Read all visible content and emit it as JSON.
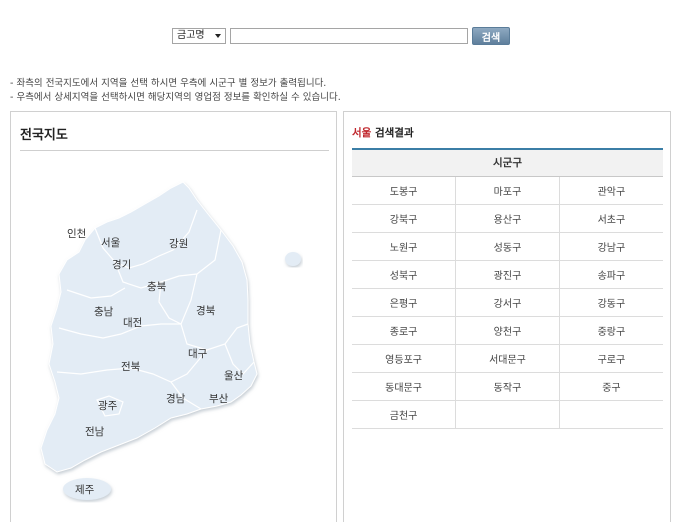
{
  "search": {
    "select_value": "금고명",
    "input_value": "",
    "button_label": "검색"
  },
  "guide": [
    "- 좌측의 전국지도에서 지역을 선택 하시면 우측에 시군구 별 정보가 출력됩니다.",
    "- 우측에서 상세지역을 선택하시면 해당지역의 영업점 정보를 확인하실 수 있습니다."
  ],
  "map": {
    "title": "전국지도",
    "regions": {
      "incheon": "인천",
      "seoul": "서울",
      "gangwon": "강원",
      "gyeonggi": "경기",
      "chungbuk": "충북",
      "chungnam": "충남",
      "daejeon": "대전",
      "gyeongbuk": "경북",
      "jeonbuk": "전북",
      "daegu": "대구",
      "ulsan": "울산",
      "gyeongnam": "경남",
      "busan": "부산",
      "gwangju": "광주",
      "jeonnam": "전남",
      "jeju": "제주"
    },
    "colors": {
      "land": "#e3ecf5",
      "border": "#ffffff"
    }
  },
  "result": {
    "city": "서울",
    "title_suffix": " 검색결과",
    "header": "시군구",
    "rows": [
      [
        "도봉구",
        "마포구",
        "관악구"
      ],
      [
        "강북구",
        "용산구",
        "서초구"
      ],
      [
        "노원구",
        "성동구",
        "강남구"
      ],
      [
        "성북구",
        "광진구",
        "송파구"
      ],
      [
        "은평구",
        "강서구",
        "강동구"
      ],
      [
        "종로구",
        "양천구",
        "중랑구"
      ],
      [
        "영등포구",
        "서대문구",
        "구로구"
      ],
      [
        "동대문구",
        "동작구",
        "중구"
      ],
      [
        "금천구",
        "",
        ""
      ]
    ],
    "accent": "#3b7ea6",
    "city_color": "#c0272d"
  }
}
